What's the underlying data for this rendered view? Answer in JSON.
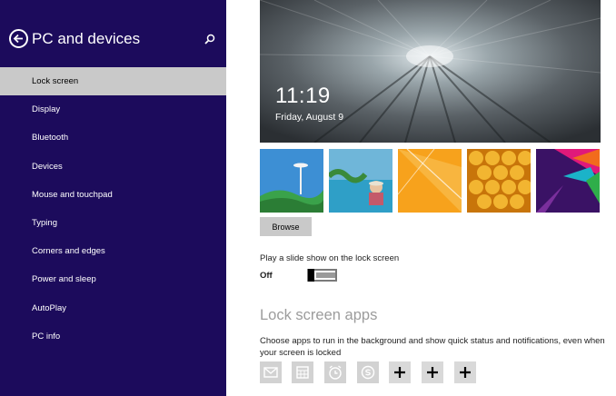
{
  "sidebar": {
    "title": "PC and devices",
    "items": [
      {
        "label": "Lock screen",
        "selected": true
      },
      {
        "label": "Display"
      },
      {
        "label": "Bluetooth"
      },
      {
        "label": "Devices"
      },
      {
        "label": "Mouse and touchpad"
      },
      {
        "label": "Typing"
      },
      {
        "label": "Corners and edges"
      },
      {
        "label": "Power and sleep"
      },
      {
        "label": "AutoPlay"
      },
      {
        "label": "PC info"
      }
    ],
    "colors": {
      "background": "#1c0b5c",
      "selected": "#c9c9c9"
    }
  },
  "preview": {
    "time": "11:19",
    "date": "Friday, August 9"
  },
  "thumbnails": [
    "space-needle-landscape",
    "pool-snorkeler-photo",
    "orange-abstract",
    "honeycomb",
    "geometric-pattern"
  ],
  "browse_label": "Browse",
  "slideshow": {
    "label": "Play a slide show on the lock screen",
    "state": "Off"
  },
  "lock_apps": {
    "title": "Lock screen apps",
    "description": "Choose apps to run in the background and show quick status and notifications, even when your screen is locked",
    "slots": [
      "mail-icon",
      "calendar-icon",
      "alarm-icon",
      "skype-icon",
      "add-icon",
      "add-icon",
      "add-icon"
    ]
  }
}
